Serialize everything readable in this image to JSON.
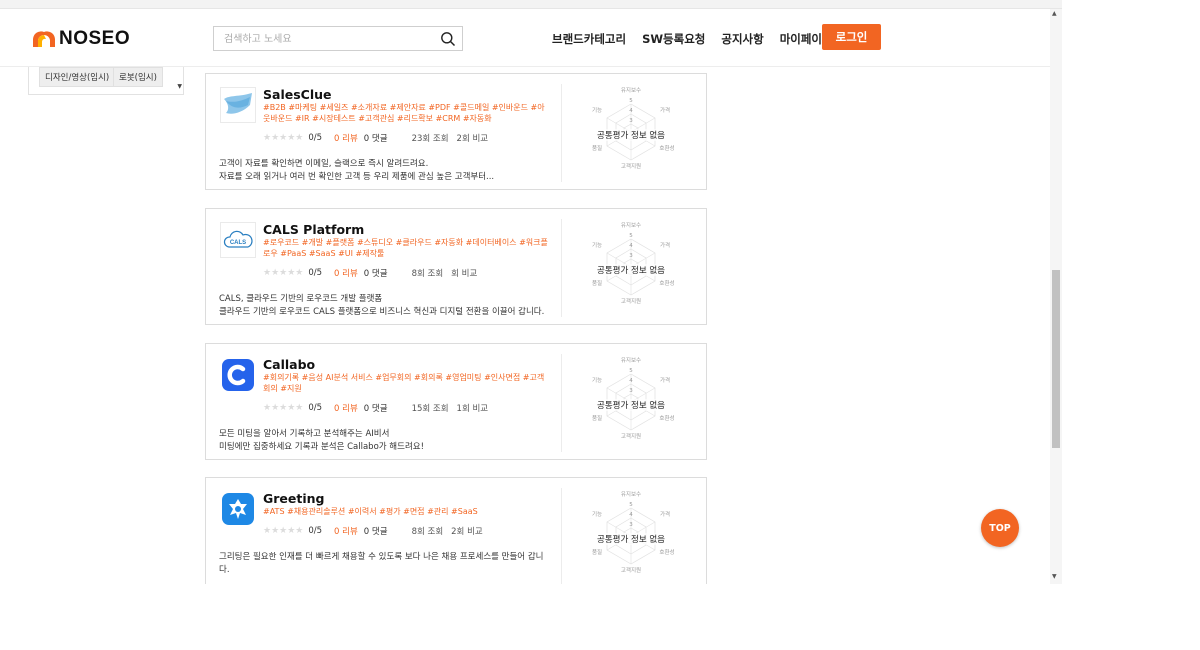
{
  "brand": {
    "name": "NOSEO",
    "accent": "#f26522"
  },
  "search": {
    "placeholder": "검색하고 노세요",
    "icon": "search-icon"
  },
  "nav": [
    {
      "label": "브랜드카테고리"
    },
    {
      "label": "SW등록요청"
    },
    {
      "label": "공지사항"
    },
    {
      "label": "마이페이지"
    }
  ],
  "login_label": "로그인",
  "sidebar": {
    "chips": [
      {
        "label": "디자인/영상(임시)"
      },
      {
        "label": "로봇(임시)"
      }
    ]
  },
  "radar_axes": {
    "top": "유지보수",
    "left": "기능",
    "right": "가격",
    "bottom_left": "품질",
    "bottom_right": "호환성",
    "bottom": "고객지원",
    "scale_5": "5",
    "scale_4": "4",
    "scale_3": "3"
  },
  "products": [
    {
      "name": "SalesClue",
      "tags": "#B2B #마케팅 #세일즈 #소개자료 #제안자료 #PDF #콜드메일 #인바운드 #아웃바운드 #IR #시장테스트 #고객관심 #리드확보 #CRM #자동화",
      "rating": "0/5",
      "reviews": "0 리뷰",
      "comments": "0 댓글",
      "views": "23회 조회",
      "compare": "2회 비교",
      "desc_line1": "고객이 자료를 확인하면 이메일, 슬랙으로 즉시 알려드려요.",
      "desc_line2": "자료를 오래 읽거나 여러 번 확인한 고객 등 우리 제품에 관심 높은 고객부터...",
      "eval": "공통평가 정보 없음",
      "logo": "salesclue-logo"
    },
    {
      "name": "CALS Platform",
      "tags": "#로우코드 #개발 #플랫폼 #스튜디오 #클라우드 #자동화 #데이터베이스 #워크플로우 #PaaS #SaaS #UI #제작툴",
      "rating": "0/5",
      "reviews": "0 리뷰",
      "comments": "0 댓글",
      "views": "8회 조회",
      "compare": "회 비교",
      "desc_line1": "CALS, 클라우드 기반의 로우코드 개발 플랫폼",
      "desc_line2": "클라우드 기반의 로우코드 CALS 플랫폼으로 비즈니스 혁신과 디지털 전환을 이끌어 갑니다.",
      "eval": "공통평가 정보 없음",
      "logo": "cals-logo",
      "logo_text": "CALS"
    },
    {
      "name": "Callabo",
      "tags": "#회의기록 #음성 AI분석 서비스 #업무회의 #회의록 #영업미팅 #인사면접 #고객회의 #지원",
      "rating": "0/5",
      "reviews": "0 리뷰",
      "comments": "0 댓글",
      "views": "15회 조회",
      "compare": "1회 비교",
      "desc_line1": "모든 미팅을 알아서 기록하고 분석해주는 AI비서",
      "desc_line2": "미팅에만 집중하세요 기록과 분석은 Callabo가 해드려요!",
      "eval": "공통평가 정보 없음",
      "logo": "callabo-logo"
    },
    {
      "name": "Greeting",
      "tags": "#ATS #채용관리솔루션 #이력서 #평가 #면접 #관리 #SaaS",
      "rating": "0/5",
      "reviews": "0 리뷰",
      "comments": "0 댓글",
      "views": "8회 조회",
      "compare": "2회 비교",
      "desc_line1": "그리팅은 필요한 인재를 더 빠르게 채용할 수 있도록 보다 나은 채용 프로세스를 만들어 갑니다.",
      "desc_line2": "",
      "eval": "공통평가 정보 없음",
      "logo": "greeting-logo"
    }
  ],
  "top_button": "TOP"
}
